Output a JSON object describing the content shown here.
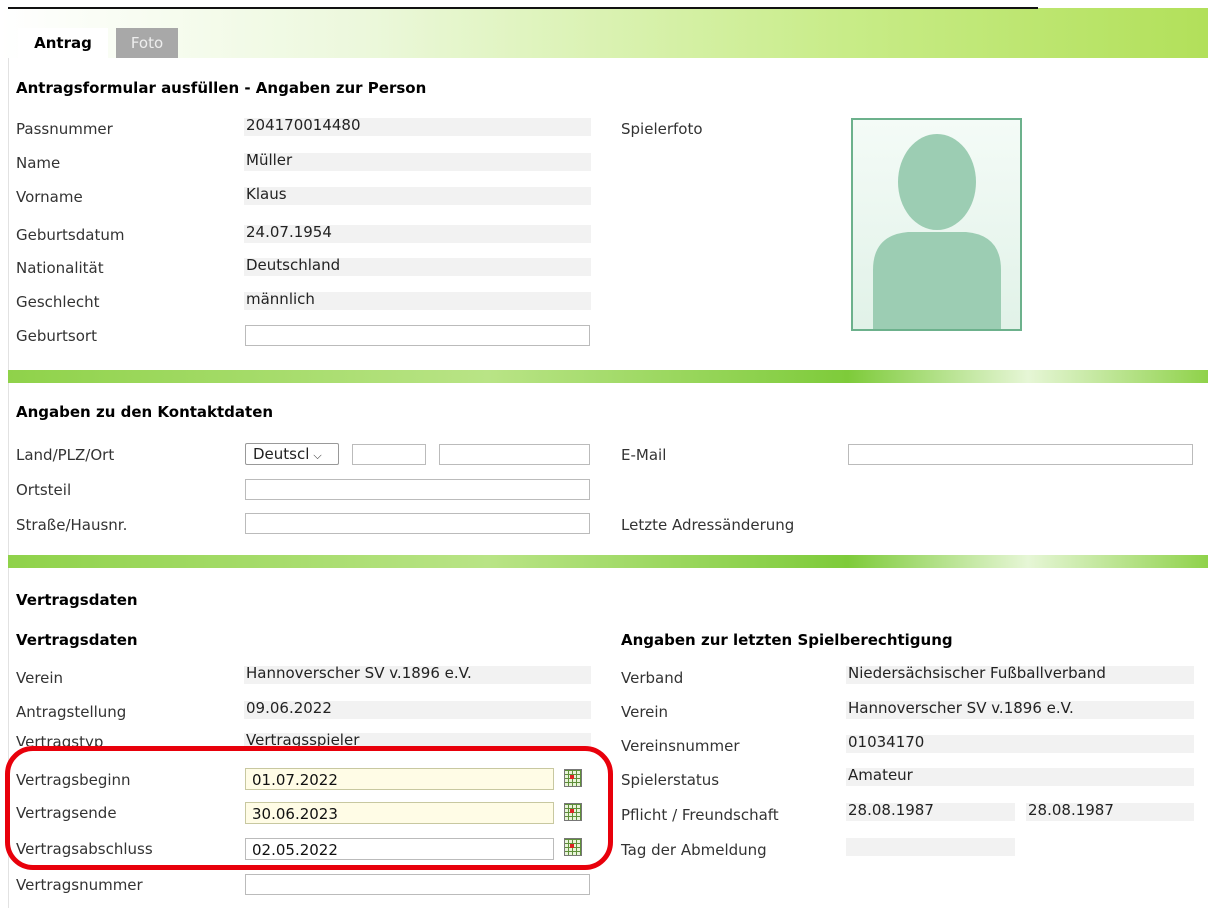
{
  "tabs": [
    {
      "label": "Antrag"
    },
    {
      "label": "Foto"
    }
  ],
  "person": {
    "heading": "Antragsformular ausfüllen - Angaben zur Person",
    "fields": [
      {
        "label": "Passnummer",
        "value": "204170014480"
      },
      {
        "label": "Name",
        "value": "Müller"
      },
      {
        "label": "Vorname",
        "value": "Klaus"
      },
      {
        "label": "Geburtsdatum",
        "value": "24.07.1954"
      },
      {
        "label": "Nationalität",
        "value": "Deutschland"
      },
      {
        "label": "Geschlecht",
        "value": "männlich"
      },
      {
        "label": "Geburtsort",
        "value": ""
      }
    ],
    "photo_label": "Spielerfoto",
    "photo_icon": "person-silhouette-icon"
  },
  "contact": {
    "heading": "Angaben zu den Kontaktdaten",
    "land_label": "Land/PLZ/Ort",
    "land_selected": "Deutscl",
    "plz_value": "",
    "ort_value": "",
    "ortsteil_label": "Ortsteil",
    "ortsteil_value": "",
    "strasse_label": "Straße/Hausnr.",
    "strasse_value": "",
    "email_label": "E-Mail",
    "email_value": "",
    "letzte_label": "Letzte Adressänderung"
  },
  "contract": {
    "heading": "Vertragsdaten",
    "subheading": "Vertragsdaten",
    "verein_label": "Verein",
    "verein_value": "Hannoverscher SV v.1896 e.V.",
    "antrag_label": "Antragstellung",
    "antrag_value": "09.06.2022",
    "typ_label": "Vertragstyp",
    "typ_value": "Vertragsspieler",
    "beginn_label": "Vertragsbeginn",
    "beginn_value": "01.07.2022",
    "ende_label": "Vertragsende",
    "ende_value": "30.06.2023",
    "abschluss_label": "Vertragsabschluss",
    "abschluss_value": "02.05.2022",
    "nummer_label": "Vertragsnummer",
    "nummer_value": ""
  },
  "last_permission": {
    "heading": "Angaben zur letzten Spielberechtigung",
    "rows": [
      {
        "label": "Verband",
        "value": "Niedersächsischer Fußballverband"
      },
      {
        "label": "Verein",
        "value": "Hannoverscher SV v.1896 e.V."
      },
      {
        "label": "Vereinsnummer",
        "value": "01034170"
      },
      {
        "label": "Spielerstatus",
        "value": "Amateur"
      }
    ],
    "pflicht_label": "Pflicht / Freundschaft",
    "pflicht_value": "28.08.1987",
    "freund_value": "28.08.1987",
    "abmeldung_label": "Tag der Abmeldung",
    "abmeldung_value": ""
  },
  "colors": {
    "highlight": "#e8000b",
    "accent": "#8fd24a",
    "photo_border": "#6cb18c"
  }
}
